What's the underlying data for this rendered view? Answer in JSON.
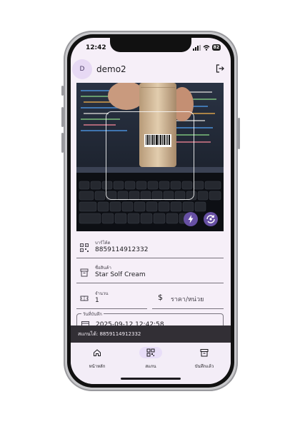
{
  "status_bar": {
    "time": "12:42",
    "battery": "82"
  },
  "header": {
    "avatar_initial": "D",
    "username": "demo2"
  },
  "form": {
    "barcode": {
      "label": "บาร์โค้ด",
      "value": "8859114912332"
    },
    "product_name": {
      "label": "ชื่อสินค้า",
      "value": "Star Solf Cream"
    },
    "quantity": {
      "label": "จำนวน",
      "value": "1"
    },
    "price": {
      "placeholder": "ราคา/หน่วย"
    },
    "expiry": {
      "label": "วันที่บันทึก",
      "value": "2025-09-12 12:42:58"
    }
  },
  "snackbar": {
    "text": "สแกนได้: 8859114912332"
  },
  "bottom_nav": {
    "items": [
      {
        "label": "หน้าหลัก",
        "icon": "home-icon"
      },
      {
        "label": "สแกน",
        "icon": "qr-scan-icon"
      },
      {
        "label": "บันทึกแล้ว",
        "icon": "archive-icon"
      }
    ],
    "selected": "สแกน"
  },
  "colors": {
    "primary": "#6750a4",
    "surface": "#f6eff8",
    "snackbar": "#322f35"
  }
}
